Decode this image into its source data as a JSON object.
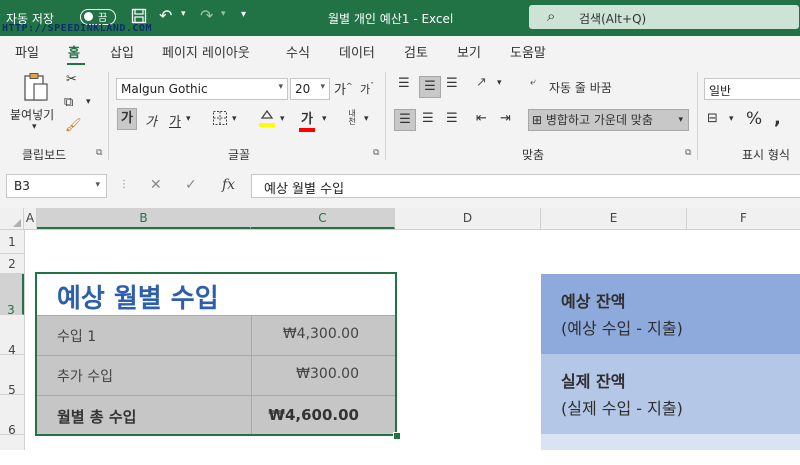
{
  "titlebar": {
    "autosave_label": "자동 저장",
    "autosave_state": "끔",
    "title": "월별 개인 예산1  -  Excel",
    "search_placeholder": "검색(Alt+Q)",
    "watermark": "HTTP://SPEEDINKLAND.COM",
    "background_color": "#217346"
  },
  "tabs": [
    {
      "label": "파일"
    },
    {
      "label": "홈",
      "active": true
    },
    {
      "label": "삽입"
    },
    {
      "label": "페이지 레이아웃"
    },
    {
      "label": "수식"
    },
    {
      "label": "데이터"
    },
    {
      "label": "검토"
    },
    {
      "label": "보기"
    },
    {
      "label": "도움말"
    }
  ],
  "ribbon": {
    "clipboard": {
      "paste_label": "붙여넣기",
      "group_label": "클립보드"
    },
    "font": {
      "font_name": "Malgun Gothic",
      "font_size": "20",
      "grow_label": "가",
      "shrink_label": "가",
      "bold_label": "가",
      "italic_label": "가",
      "underline_label": "가",
      "font_color_label": "가",
      "phonetic_label": "내천",
      "group_label": "글꼴",
      "highlight_color": "#ffff00",
      "font_color": "#ff0000"
    },
    "alignment": {
      "wrap_label": "자동 줄 바꿈",
      "merge_label": "병합하고 가운데 맞춤",
      "group_label": "맞춤"
    },
    "number": {
      "format": "일반",
      "percent_label": "%",
      "group_label": "표시 형식"
    }
  },
  "formula_bar": {
    "name_box": "B3",
    "formula": "예상 월별 수입",
    "fx_label": "fx"
  },
  "columns": [
    "A",
    "B",
    "C",
    "D",
    "E",
    "F"
  ],
  "rows": [
    "1",
    "2",
    "3",
    "4",
    "5",
    "6"
  ],
  "income_table": {
    "title": "예상 월별 수입",
    "rows": [
      {
        "label": "수입 1",
        "value": "₩4,300.00"
      },
      {
        "label": "추가 수입",
        "value": "₩300.00"
      },
      {
        "label": "월별 총 수입",
        "value": "₩4,600.00"
      }
    ],
    "title_color": "#2e5fae",
    "row_color": "#c6c6c6"
  },
  "balance_panel": [
    {
      "heading": "예상 잔액",
      "sub": "(예상 수입 - 지출)",
      "color": "#8ea9db"
    },
    {
      "heading": "실제 잔액",
      "sub": "(실제 수입 - 지출)",
      "color": "#b4c7e7"
    }
  ]
}
